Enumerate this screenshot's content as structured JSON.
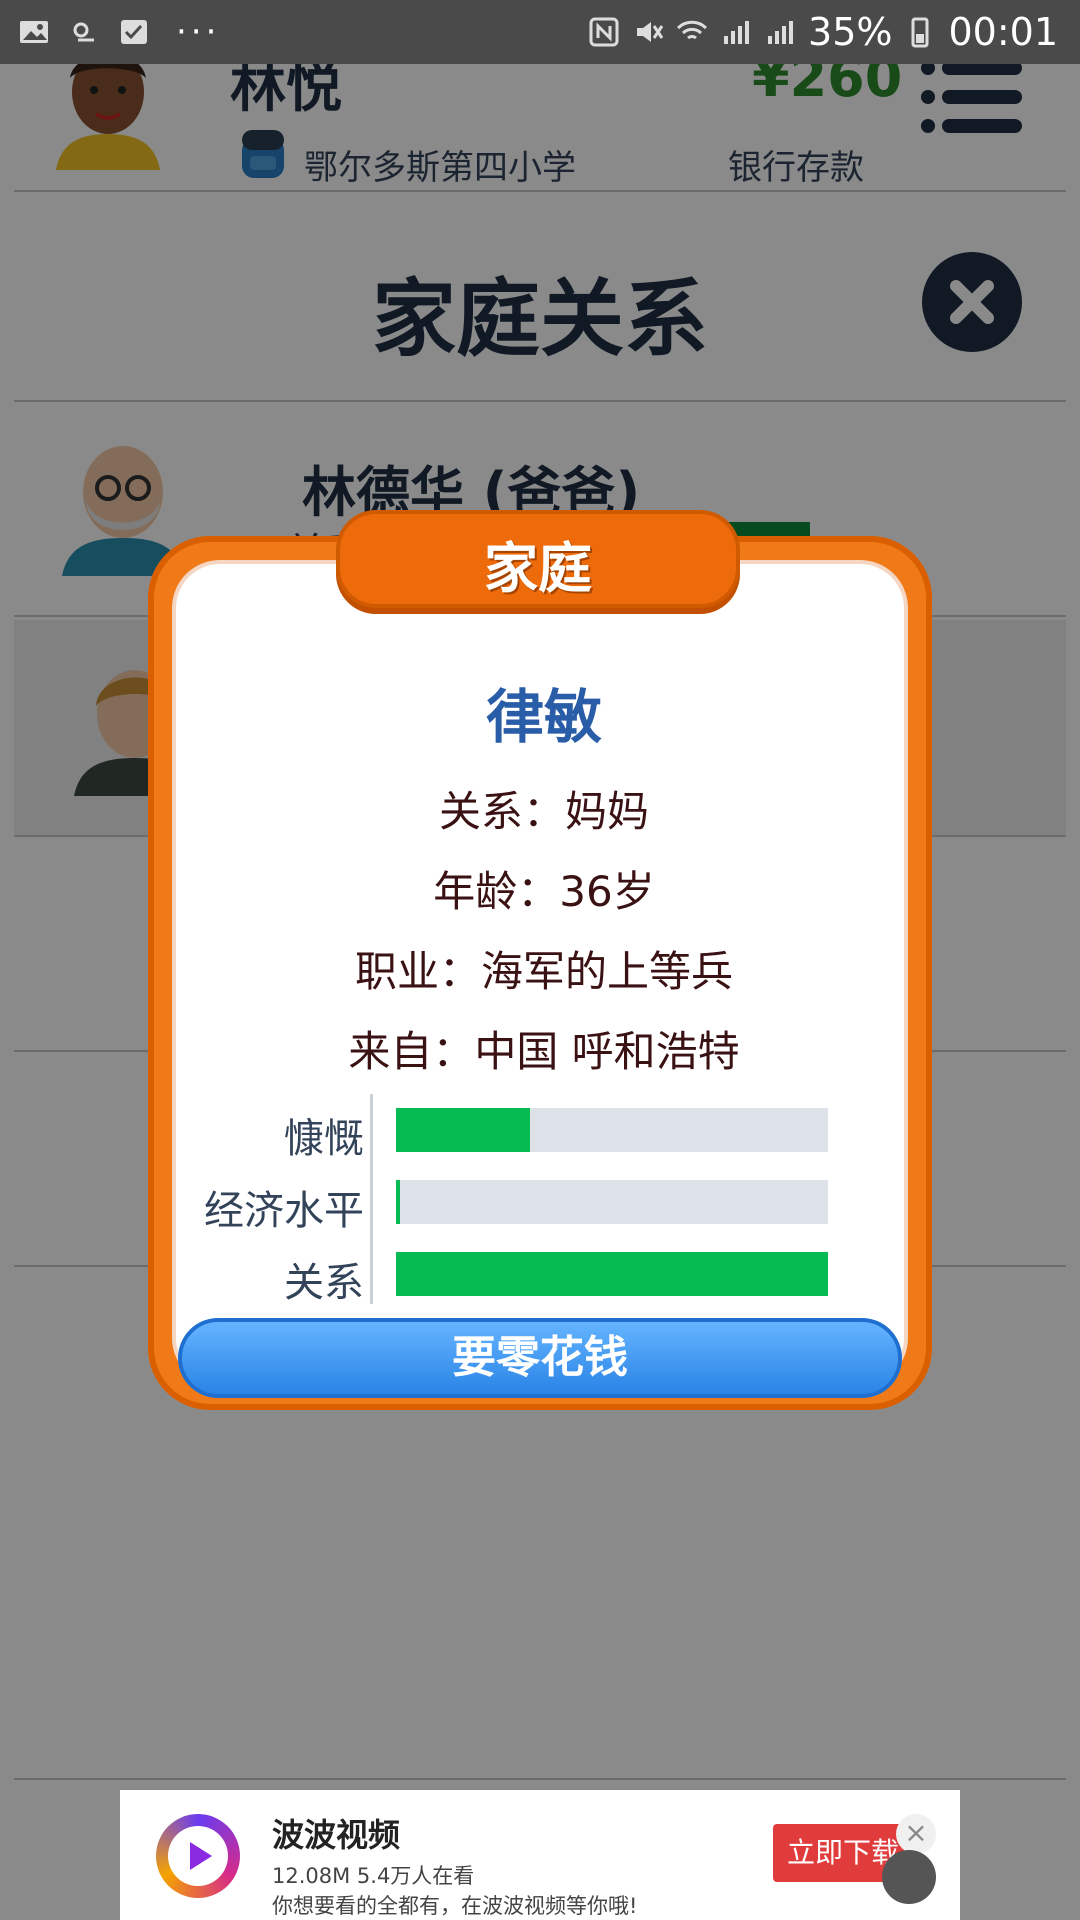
{
  "status_bar": {
    "battery": "35%",
    "time": "00:01",
    "dots": "···"
  },
  "header": {
    "player_name": "林悦",
    "school": "鄂尔多斯第四小学",
    "money": "¥260",
    "money_label": "银行存款"
  },
  "page": {
    "title": "家庭关系"
  },
  "members": [
    {
      "name": "林德华 (爸爸)",
      "relation_label": "关系"
    }
  ],
  "modal": {
    "tab_label": "家庭",
    "person_name": "律敏",
    "relation_line": "关系：妈妈",
    "age_line": "年龄：36岁",
    "job_line": "职业：海军的上等兵",
    "origin_line": "来自：中国 呼和浩特",
    "stats": [
      {
        "label": "慷慨",
        "value": 0.31
      },
      {
        "label": "经济水平",
        "value": 0.01
      },
      {
        "label": "关系",
        "value": 1.0
      }
    ],
    "action_button": "要零花钱"
  },
  "ad": {
    "title": "波波视频",
    "subtitle1": "12.08M 5.4万人在看",
    "subtitle2": "你想要看的全都有，在波波视频等你哦!",
    "cta": "立即下载",
    "close": "×"
  },
  "colors": {
    "accent_orange": "#f07a18",
    "bar_green": "#06bb52",
    "button_blue": "#2a84e6",
    "name_blue": "#2a5da8"
  }
}
